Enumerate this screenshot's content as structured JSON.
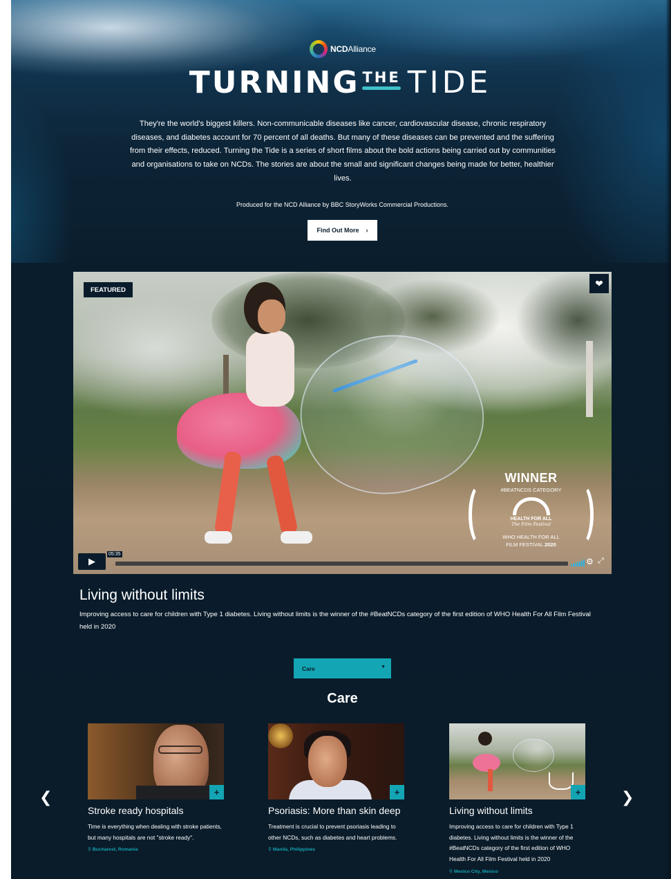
{
  "brand": {
    "logo_bold": "NCD",
    "logo_light": "Alliance"
  },
  "hero": {
    "title_word1": "TURNING",
    "title_word2": "THE",
    "title_word3": "TIDE",
    "intro": "They're the world's biggest killers. Non-communicable diseases like cancer, cardiovascular disease, chronic respiratory diseases, and diabetes account for 70 percent of all deaths. But many of these diseases can be prevented and the suffering from their effects, reduced. Turning the Tide is a series of short films about the bold actions being carried out by communities and organisations to take on NCDs. The stories are about the small and significant changes being made for better, healthier lives.",
    "produced": "Produced for the NCD Alliance by BBC StoryWorks Commercial Productions.",
    "cta_label": "Find Out More",
    "cta_icon": "chevron-right-icon"
  },
  "featured": {
    "tag": "FEATURED",
    "favorite_icon": "heart-icon",
    "award": {
      "heading": "WINNER",
      "category": "#BEATNCDS CATEGORY",
      "logo_line1": "HEALTH FOR ALL",
      "logo_line2": "The Film Festival",
      "festival_line1": "WHO HEALTH FOR ALL",
      "festival_line2": "FILM FESTIVAL",
      "festival_year": "2020"
    },
    "player": {
      "duration": "05:35",
      "progress": 0,
      "play_icon": "play-icon",
      "volume_icon": "volume-icon",
      "settings_icon": "gear-icon",
      "fullscreen_icon": "fullscreen-icon"
    },
    "title": "Living without limits",
    "description": "Improving access to care for children with Type 1 diabetes. Living without limits is the winner of the #BeatNCDs category of the first edition of WHO Health For All Film Festival held in 2020"
  },
  "filter": {
    "selected": "Care",
    "icon": "chevron-down-icon"
  },
  "section": {
    "title": "Care"
  },
  "carousel": {
    "prev_icon": "chevron-left-icon",
    "next_icon": "chevron-right-icon",
    "cards": [
      {
        "title": "Stroke ready hospitals",
        "description": "Time is everything when dealing with stroke patients, but many hospitals are not \"stroke ready\".",
        "location": "Bucharest, Romania"
      },
      {
        "title": "Psoriasis: More than skin deep",
        "description": "Treatment is crucial to prevent psoriasis leading to other NCDs, such as diabetes and heart problems.",
        "location": "Manila, Philippines"
      },
      {
        "title": "Living without limits",
        "description": "Improving access to care for children with Type 1 diabetes. Living without limits is the winner of the #BeatNCDs category of the first edition of WHO Health For All Film Festival held in 2020",
        "location": "Mexico City, Mexico"
      }
    ]
  },
  "colors": {
    "background": "#0a1c2b",
    "accent": "#14a5b4",
    "title_underline": "#3fc1c9"
  }
}
